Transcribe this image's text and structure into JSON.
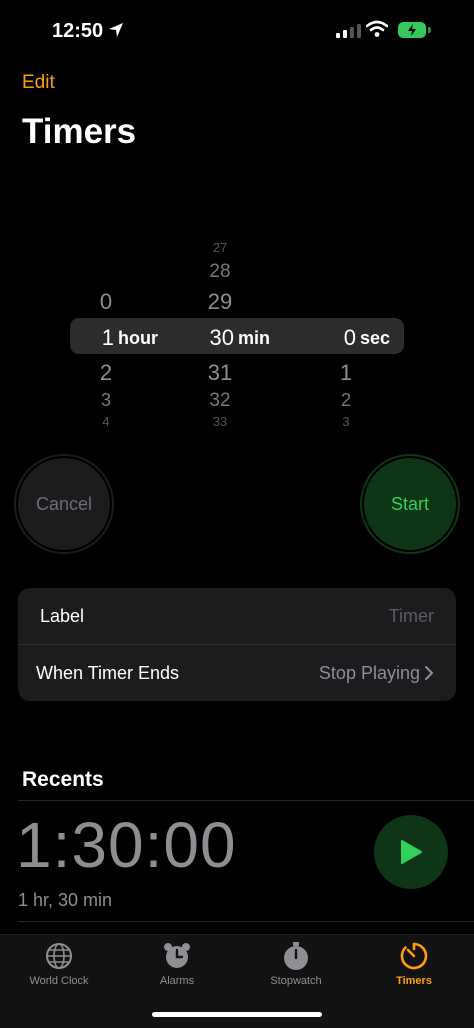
{
  "status_bar": {
    "time": "12:50"
  },
  "header": {
    "edit_label": "Edit",
    "title": "Timers"
  },
  "picker": {
    "hours": {
      "above": [
        "0"
      ],
      "selected": "1",
      "below": [
        "2",
        "3",
        "4"
      ],
      "unit": "hour"
    },
    "minutes": {
      "above": [
        "27",
        "28",
        "29"
      ],
      "selected": "30",
      "below": [
        "31",
        "32",
        "33"
      ],
      "unit": "min"
    },
    "seconds": {
      "above": [],
      "selected": "0",
      "below": [
        "1",
        "2",
        "3"
      ],
      "unit": "sec"
    }
  },
  "buttons": {
    "cancel": "Cancel",
    "start": "Start"
  },
  "options": {
    "label": {
      "title": "Label",
      "placeholder": "Timer"
    },
    "when_ends": {
      "title": "When Timer Ends",
      "value": "Stop Playing"
    }
  },
  "recents": {
    "title": "Recents",
    "items": [
      {
        "time": "1:30:00",
        "label": "1 hr, 30 min"
      }
    ]
  },
  "tabbar": {
    "tabs": [
      {
        "label": "World Clock",
        "icon": "globe-icon"
      },
      {
        "label": "Alarms",
        "icon": "alarm-clock-icon"
      },
      {
        "label": "Stopwatch",
        "icon": "stopwatch-icon"
      },
      {
        "label": "Timers",
        "icon": "timer-icon",
        "active": true
      }
    ]
  },
  "colors": {
    "accent": "#ff9f0a",
    "start_green": "#30d158",
    "background": "#000000"
  }
}
